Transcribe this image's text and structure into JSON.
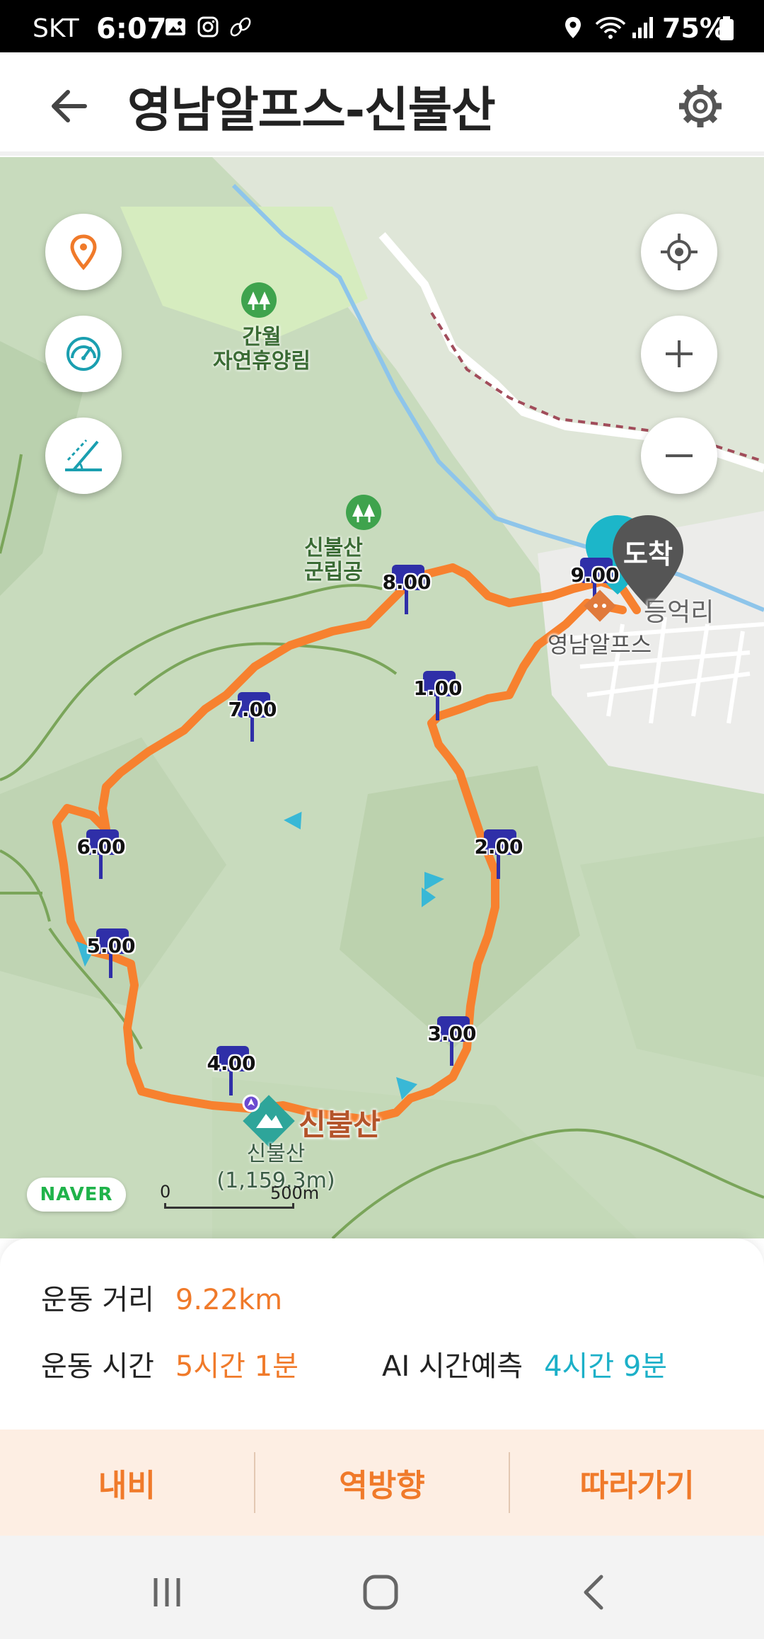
{
  "status_bar": {
    "carrier": "SKT",
    "time": "6:07",
    "battery": "75%",
    "icons": [
      "gallery-icon",
      "instagram-icon",
      "steps-icon",
      "location-icon",
      "wifi-icon",
      "signal-icon",
      "battery-icon"
    ]
  },
  "header": {
    "title": "영남알프스-신불산",
    "back_icon": "arrow-left-icon",
    "settings_icon": "gear-icon"
  },
  "map": {
    "left_controls": [
      "location-pin-icon",
      "speedometer-icon",
      "slope-icon"
    ],
    "right_controls": [
      "my-location-icon",
      "zoom-in-icon",
      "zoom-out-icon"
    ],
    "places": {
      "forest1": "간월\n자연휴양림",
      "forest2": "신불산\n군립공",
      "summit_name": "신불산",
      "summit_sub": "신불산\n(1,159.3m)",
      "end_place": "영남알프스",
      "village": "등억리"
    },
    "km_markers": [
      "1.00",
      "2.00",
      "3.00",
      "4.00",
      "5.00",
      "6.00",
      "7.00",
      "8.00",
      "9.00"
    ],
    "arrival_label": "도착",
    "naver_logo": "NAVER",
    "scale_zero": "0",
    "scale_distance": "500m",
    "colors": {
      "route": "#f7812f",
      "marker": "#2f2fa8",
      "terrain": "#c9dcc0",
      "arrival_pin": "#555555",
      "start_pin": "#1cb6c9"
    }
  },
  "info": {
    "distance_label": "운동 거리",
    "distance_value": "9.22km",
    "time_label": "운동 시간",
    "time_value": "5시간 1분",
    "ai_label": "AI 시간예측",
    "ai_value": "4시간 9분"
  },
  "actions": {
    "navigate": "내비",
    "reverse": "역방향",
    "follow": "따라가기"
  },
  "nav_bar": [
    "recent-apps-icon",
    "home-icon",
    "back-icon"
  ]
}
